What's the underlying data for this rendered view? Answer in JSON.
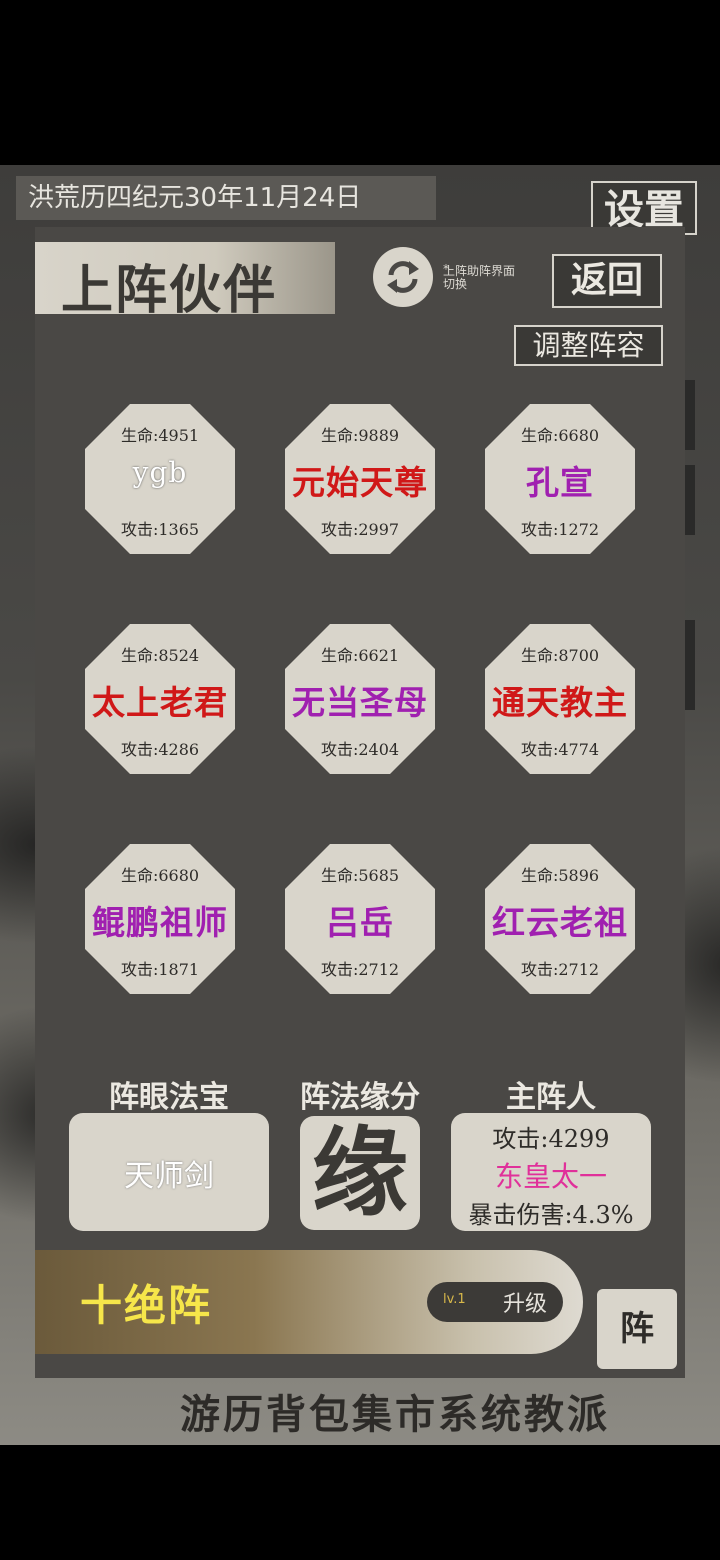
{
  "background": {
    "date": "洪荒历四纪元30年11月24日",
    "settings_label": "设置",
    "nav_items": [
      "游历",
      "背包",
      "集市",
      "系统",
      "教派"
    ]
  },
  "panel": {
    "title": "上阵伙伴",
    "switch_note": "上阵助阵界面切换",
    "switch_star": "*",
    "back_label": "返回",
    "adjust_label": "调整阵容",
    "icons": {
      "switch": "refresh-icon"
    }
  },
  "partners": [
    {
      "name": "ygb",
      "hp": "生命:4951",
      "atk": "攻击:1365",
      "color": "#ffffff"
    },
    {
      "name": "元始天尊",
      "hp": "生命:9889",
      "atk": "攻击:2997",
      "color": "#d01818"
    },
    {
      "name": "孔宣",
      "hp": "生命:6680",
      "atk": "攻击:1272",
      "color": "#a020b0"
    },
    {
      "name": "太上老君",
      "hp": "生命:8524",
      "atk": "攻击:4286",
      "color": "#d01818"
    },
    {
      "name": "无当圣母",
      "hp": "生命:6621",
      "atk": "攻击:2404",
      "color": "#a020b0"
    },
    {
      "name": "通天教主",
      "hp": "生命:8700",
      "atk": "攻击:4774",
      "color": "#d01818"
    },
    {
      "name": "鲲鹏祖师",
      "hp": "生命:6680",
      "atk": "攻击:1871",
      "color": "#a020b0"
    },
    {
      "name": "吕岳",
      "hp": "生命:5685",
      "atk": "攻击:2712",
      "color": "#a020b0"
    },
    {
      "name": "红云老祖",
      "hp": "生命:5896",
      "atk": "攻击:2712",
      "color": "#a020b0"
    }
  ],
  "sections": {
    "eye_label": "阵眼法宝",
    "eye_item": "天师剑",
    "fate_label": "阵法缘分",
    "fate_char": "缘",
    "master_label": "主阵人",
    "master_atk": "攻击:4299",
    "master_name": "东皇太一",
    "master_crit": "暴击伤害:4.3%",
    "master_name_color": "#e0309a"
  },
  "formation": {
    "name": "十绝阵",
    "level": "lv.1",
    "upgrade_label": "升级",
    "side_label": "阵"
  }
}
